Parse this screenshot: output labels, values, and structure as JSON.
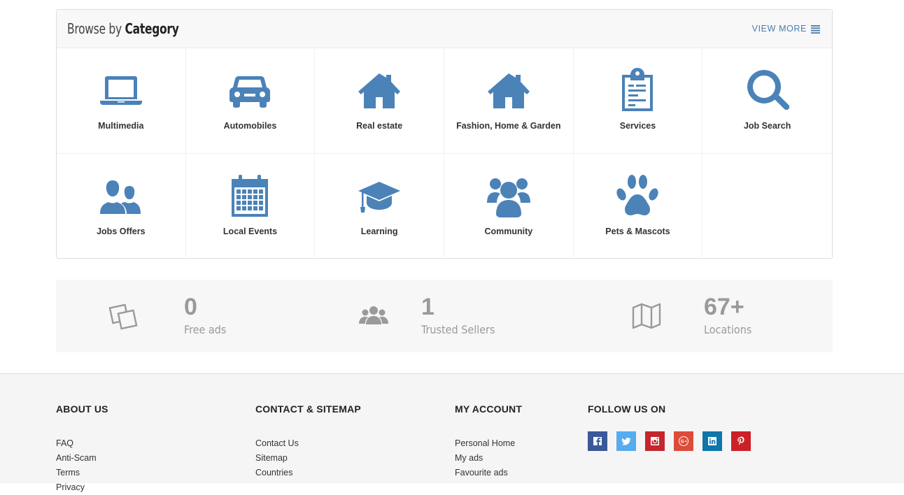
{
  "category_panel": {
    "title_light": "Browse by",
    "title_bold": "Category",
    "view_more": "VIEW MORE",
    "categories": [
      {
        "label": "Multimedia",
        "icon": "laptop-icon"
      },
      {
        "label": "Automobiles",
        "icon": "car-icon"
      },
      {
        "label": "Real estate",
        "icon": "house-icon"
      },
      {
        "label": "Fashion, Home & Garden",
        "icon": "house-icon"
      },
      {
        "label": "Services",
        "icon": "clipboard-icon"
      },
      {
        "label": "Job Search",
        "icon": "search-icon"
      },
      {
        "label": "Jobs Offers",
        "icon": "users-icon"
      },
      {
        "label": "Local Events",
        "icon": "calendar-icon"
      },
      {
        "label": "Learning",
        "icon": "graduation-cap-icon"
      },
      {
        "label": "Community",
        "icon": "community-icon"
      },
      {
        "label": "Pets & Mascots",
        "icon": "paw-icon"
      }
    ],
    "icon_color": "#4b82b8"
  },
  "stats": [
    {
      "value": "0",
      "label": "Free ads",
      "icon": "ads-icon"
    },
    {
      "value": "1",
      "label": "Trusted Sellers",
      "icon": "users-icon"
    },
    {
      "value": "67+",
      "label": "Locations",
      "icon": "map-icon"
    }
  ],
  "footer": {
    "about": {
      "heading": "ABOUT US",
      "links": [
        "FAQ",
        "Anti-Scam",
        "Terms",
        "Privacy"
      ]
    },
    "contact": {
      "heading": "CONTACT & SITEMAP",
      "links": [
        "Contact Us",
        "Sitemap",
        "Countries"
      ]
    },
    "account": {
      "heading": "MY ACCOUNT",
      "links": [
        "Personal Home",
        "My ads",
        "Favourite ads"
      ]
    },
    "follow": {
      "heading": "FOLLOW US ON",
      "networks": [
        {
          "name": "facebook-icon",
          "color": "#3b5998"
        },
        {
          "name": "twitter-icon",
          "color": "#55acee"
        },
        {
          "name": "instagram-icon",
          "color": "#c4262c"
        },
        {
          "name": "google-plus-icon",
          "color": "#dd4b39"
        },
        {
          "name": "linkedin-icon",
          "color": "#0e76a8"
        },
        {
          "name": "pinterest-icon",
          "color": "#cb2027"
        }
      ]
    }
  }
}
